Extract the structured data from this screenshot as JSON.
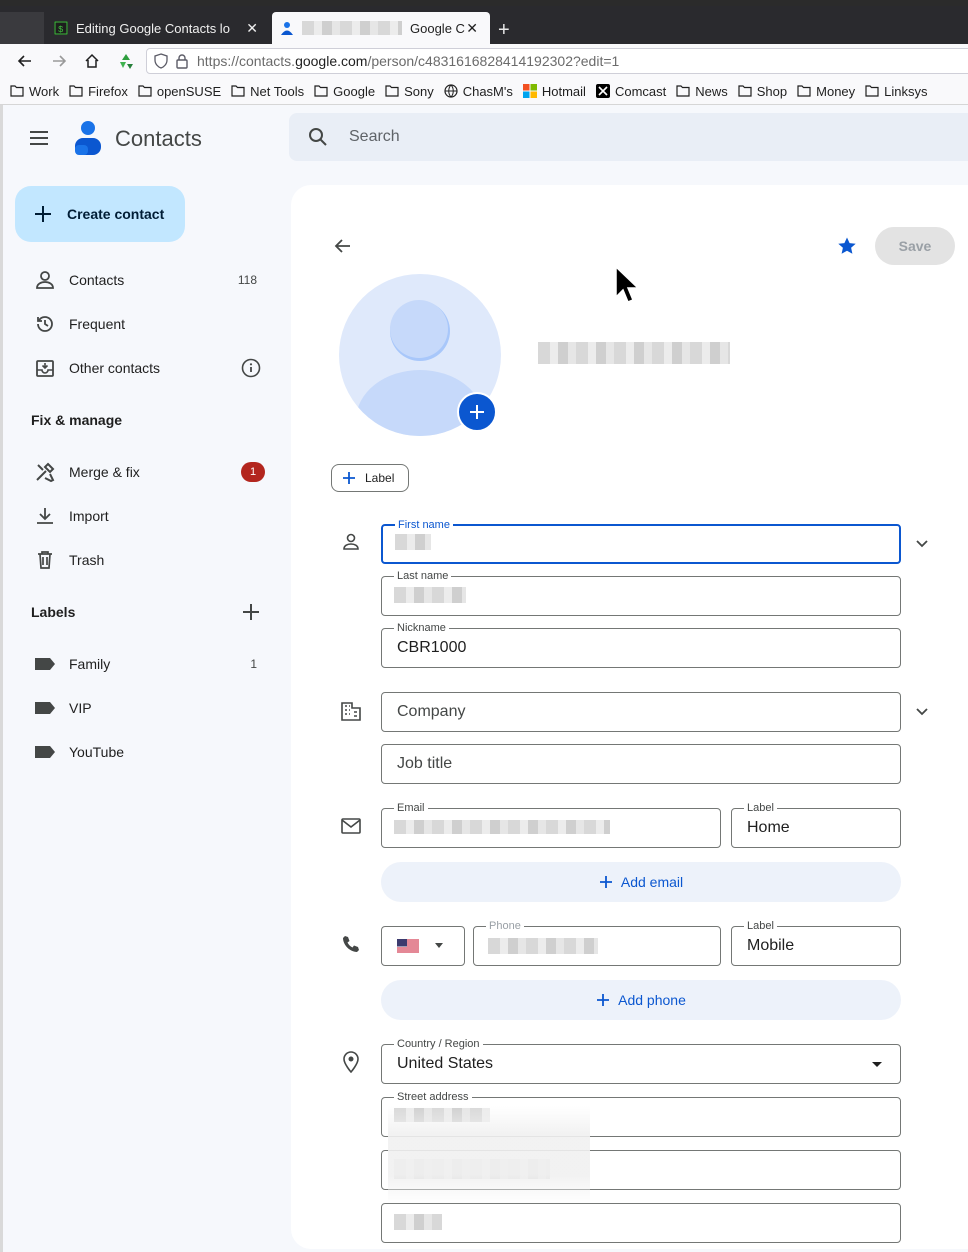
{
  "browser": {
    "tabs": [
      {
        "title": "Editing Google Contacts lo"
      },
      {
        "title": "Google C"
      }
    ],
    "url": {
      "prefix": "https://contacts.",
      "domain": "google.com",
      "path": "/person/c4831616828414192302?edit=1"
    },
    "bookmarks": [
      "Work",
      "Firefox",
      "openSUSE",
      "Net Tools",
      "Google",
      "Sony",
      "ChasM's",
      "Hotmail",
      "Comcast",
      "News",
      "Shop",
      "Money",
      "Linksys"
    ]
  },
  "app": {
    "title": "Contacts",
    "search_placeholder": "Search"
  },
  "sidebar": {
    "create_label": "Create contact",
    "items": [
      {
        "label": "Contacts",
        "count": "118"
      },
      {
        "label": "Frequent"
      },
      {
        "label": "Other contacts"
      }
    ],
    "fix_heading": "Fix & manage",
    "fix_items": [
      {
        "label": "Merge & fix",
        "badge": "1"
      },
      {
        "label": "Import"
      },
      {
        "label": "Trash"
      }
    ],
    "labels_heading": "Labels",
    "labels": [
      {
        "label": "Family",
        "count": "1"
      },
      {
        "label": "VIP"
      },
      {
        "label": "YouTube"
      }
    ]
  },
  "editor": {
    "save_label": "Save",
    "label_chip": "Label",
    "name": {
      "first_label": "First name",
      "last_label": "Last name",
      "nickname_label": "Nickname",
      "nickname_value": "CBR1000"
    },
    "company_placeholder": "Company",
    "job_title_placeholder": "Job title",
    "email": {
      "label": "Email",
      "type_label": "Label",
      "type_value": "Home",
      "add_label": "Add email"
    },
    "phone": {
      "label": "Phone",
      "type_label": "Label",
      "type_value": "Mobile",
      "add_label": "Add phone"
    },
    "address": {
      "country_label": "Country / Region",
      "country_value": "United States",
      "street_label": "Street address"
    }
  },
  "colors": {
    "accent": "#0b57d0",
    "create_bg": "#c2e7ff",
    "badge": "#b3261e",
    "app_bg": "#f6f8fc"
  }
}
